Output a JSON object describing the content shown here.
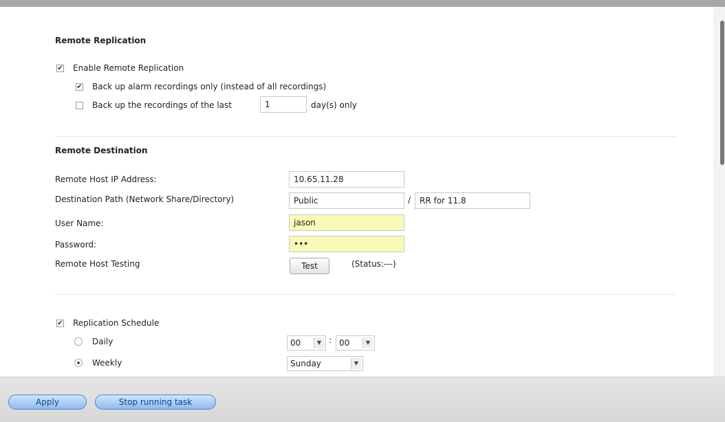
{
  "remote_replication": {
    "title": "Remote Replication",
    "enable_label": "Enable Remote Replication",
    "alarm_only_label": "Back up alarm recordings only (instead of all recordings)",
    "last_days_label": "Back up the recordings of the last",
    "last_days_value": "1",
    "days_suffix": "day(s) only",
    "check_mark": "✔"
  },
  "remote_destination": {
    "title": "Remote Destination",
    "ip_label": "Remote Host IP Address:",
    "ip_value": "10.65.11.28",
    "path_label": "Destination Path (Network Share/Directory)",
    "share_value": "Public",
    "separator": "/",
    "directory_value": "RR for 11.8",
    "user_label": "User Name:",
    "user_value": "jason",
    "password_label": "Password:",
    "password_value": "•••",
    "testing_label": "Remote Host Testing",
    "test_button": "Test",
    "status_text": "(Status:---)"
  },
  "schedule": {
    "label": "Replication Schedule",
    "daily_label": "Daily",
    "weekly_label": "Weekly",
    "hour_value": "00",
    "minute_value": "00",
    "time_separator": ":",
    "day_value": "Sunday",
    "arrow": "▼"
  },
  "footer": {
    "apply_label": "Apply",
    "stop_label": "Stop running task"
  }
}
